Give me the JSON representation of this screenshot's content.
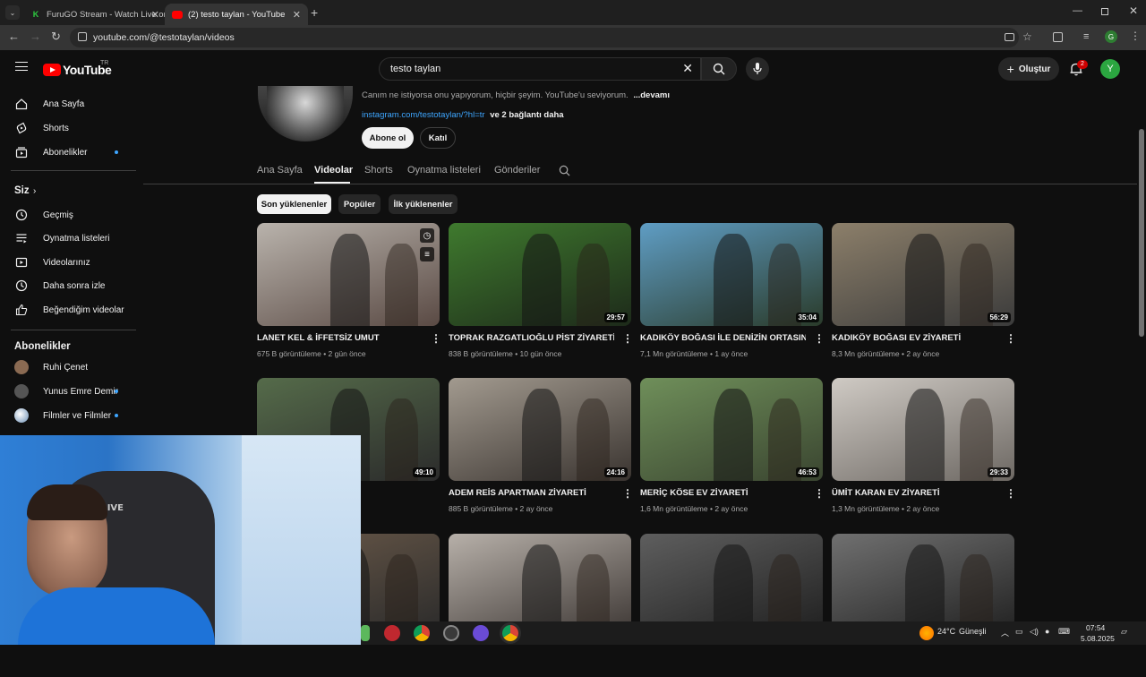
{
  "browser": {
    "tabs": [
      {
        "title": "FuruGO Stream - Watch Live on",
        "active": false
      },
      {
        "title": "(2) testo taylan - YouTube",
        "active": true
      }
    ],
    "url": "youtube.com/@testotaylan/videos",
    "profile_letter": "G"
  },
  "header": {
    "logo_text": "YouTube",
    "logo_region": "TR",
    "search_value": "testo taylan",
    "create_label": "Oluştur",
    "notif_count": "2",
    "avatar_letter": "Y"
  },
  "sidebar": {
    "main": [
      {
        "label": "Ana Sayfa",
        "icon": "home-icon"
      },
      {
        "label": "Shorts",
        "icon": "shorts-icon"
      },
      {
        "label": "Abonelikler",
        "icon": "subscriptions-icon",
        "dot": true
      }
    ],
    "you_label": "Siz",
    "you": [
      {
        "label": "Geçmiş",
        "icon": "history-icon"
      },
      {
        "label": "Oynatma listeleri",
        "icon": "playlists-icon"
      },
      {
        "label": "Videolarınız",
        "icon": "your-videos-icon"
      },
      {
        "label": "Daha sonra izle",
        "icon": "watch-later-icon"
      },
      {
        "label": "Beğendiğim videolar",
        "icon": "like-icon"
      }
    ],
    "subs_label": "Abonelikler",
    "subs": [
      {
        "label": "Ruhi Çenet",
        "color": "#8a6a52",
        "dot": false
      },
      {
        "label": "Yunus Emre Demir",
        "color": "#555555",
        "dot": true
      },
      {
        "label": "Filmler ve Filmler",
        "color": "#d9d9d9",
        "dot": true
      }
    ]
  },
  "channel": {
    "description": "Canım ne istiyorsa onu yapıyorum, hiçbir şeyim. YouTube'u seviyorum.",
    "more": "...devamı",
    "link": "instagram.com/testotaylan/?hl=tr",
    "link_more": "ve 2 bağlantı daha",
    "subscribe_label": "Abone ol",
    "join_label": "Katıl",
    "tabs": [
      "Ana Sayfa",
      "Videolar",
      "Shorts",
      "Oynatma listeleri",
      "Gönderiler"
    ],
    "active_tab": "Videolar",
    "chips": [
      "Son yüklenenler",
      "Popüler",
      "İlk yüklenenler"
    ]
  },
  "videos": [
    {
      "title": "LANET KEL & İFFETSİZ UMUT",
      "views": "675 B görüntüleme",
      "age": "2 gün önce",
      "duration": ""
    },
    {
      "title": "TOPRAK RAZGATLIOĞLU PİST ZİYARETİ",
      "views": "838 B görüntüleme",
      "age": "10 gün önce",
      "duration": "29:57"
    },
    {
      "title": "KADIKÖY BOĞASI İLE DENİZİN ORTASINDA",
      "views": "7,1 Mn görüntüleme",
      "age": "1 ay önce",
      "duration": "35:04"
    },
    {
      "title": "KADIKÖY BOĞASI EV ZİYARETİ",
      "views": "8,3 Mn görüntüleme",
      "age": "2 ay önce",
      "duration": "56:29"
    },
    {
      "title": "",
      "views": "",
      "age": "",
      "duration": "49:10"
    },
    {
      "title": "ADEM REİS APARTMAN ZİYARETİ",
      "views": "885 B görüntüleme",
      "age": "2 ay önce",
      "duration": "24:16"
    },
    {
      "title": "MERİÇ KÖSE EV ZİYARETİ",
      "views": "1,6 Mn görüntüleme",
      "age": "2 ay önce",
      "duration": "46:53"
    },
    {
      "title": "ÜMİT KARAN EV ZİYARETİ",
      "views": "1,3 Mn görüntüleme",
      "age": "2 ay önce",
      "duration": "29:33"
    },
    {
      "title": "",
      "views": "",
      "age": "",
      "duration": ""
    },
    {
      "title": "",
      "views": "",
      "age": "",
      "duration": ""
    },
    {
      "title": "",
      "views": "",
      "age": "",
      "duration": ""
    },
    {
      "title": "",
      "views": "",
      "age": "",
      "duration": ""
    }
  ],
  "thumb_colors": [
    [
      "#b9b3ac",
      "#5a4a44"
    ],
    [
      "#3f7a2e",
      "#1d2a1a"
    ],
    [
      "#5f9dc4",
      "#2a3b2a"
    ],
    [
      "#8c7f6a",
      "#3b3b3b"
    ],
    [
      "#556b4a",
      "#2b2b2b"
    ],
    [
      "#a29a8f",
      "#3a3430"
    ],
    [
      "#6f8f5a",
      "#3a4530"
    ],
    [
      "#cfcac4",
      "#6d6863"
    ],
    [
      "#6b5a4a",
      "#2a2a2a"
    ],
    [
      "#b7b0a9",
      "#3c3633"
    ],
    [
      "#5e5e5e",
      "#1f1f1f"
    ],
    [
      "#707070",
      "#202020"
    ]
  ],
  "taskbar": {
    "weather": "24°C",
    "weather_text": "Güneşli",
    "time": "07:54",
    "date": "5.08.2025"
  }
}
